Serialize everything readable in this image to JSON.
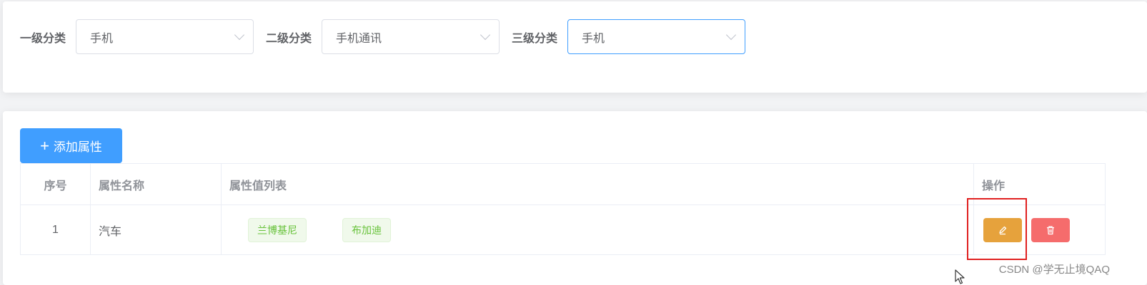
{
  "filters": {
    "level1": {
      "label": "一级分类",
      "value": "手机"
    },
    "level2": {
      "label": "二级分类",
      "value": "手机通讯"
    },
    "level3": {
      "label": "三级分类",
      "value": "手机"
    }
  },
  "toolbar": {
    "add_label": "添加属性"
  },
  "table": {
    "headers": {
      "index": "序号",
      "name": "属性名称",
      "values": "属性值列表",
      "ops": "操作"
    },
    "rows": [
      {
        "index": "1",
        "name": "汽车",
        "values": [
          "兰博基尼",
          "布加迪"
        ]
      }
    ]
  },
  "watermark": "CSDN @学无止境QAQ",
  "colors": {
    "primary": "#409eff",
    "warning": "#e6a23c",
    "danger": "#f56c6c",
    "success_text": "#67c23a",
    "highlight": "#e02020"
  },
  "icons": {
    "edit": "edit-icon",
    "delete": "trash-icon",
    "add": "plus-icon",
    "select_arrow": "chevron-down-icon"
  }
}
